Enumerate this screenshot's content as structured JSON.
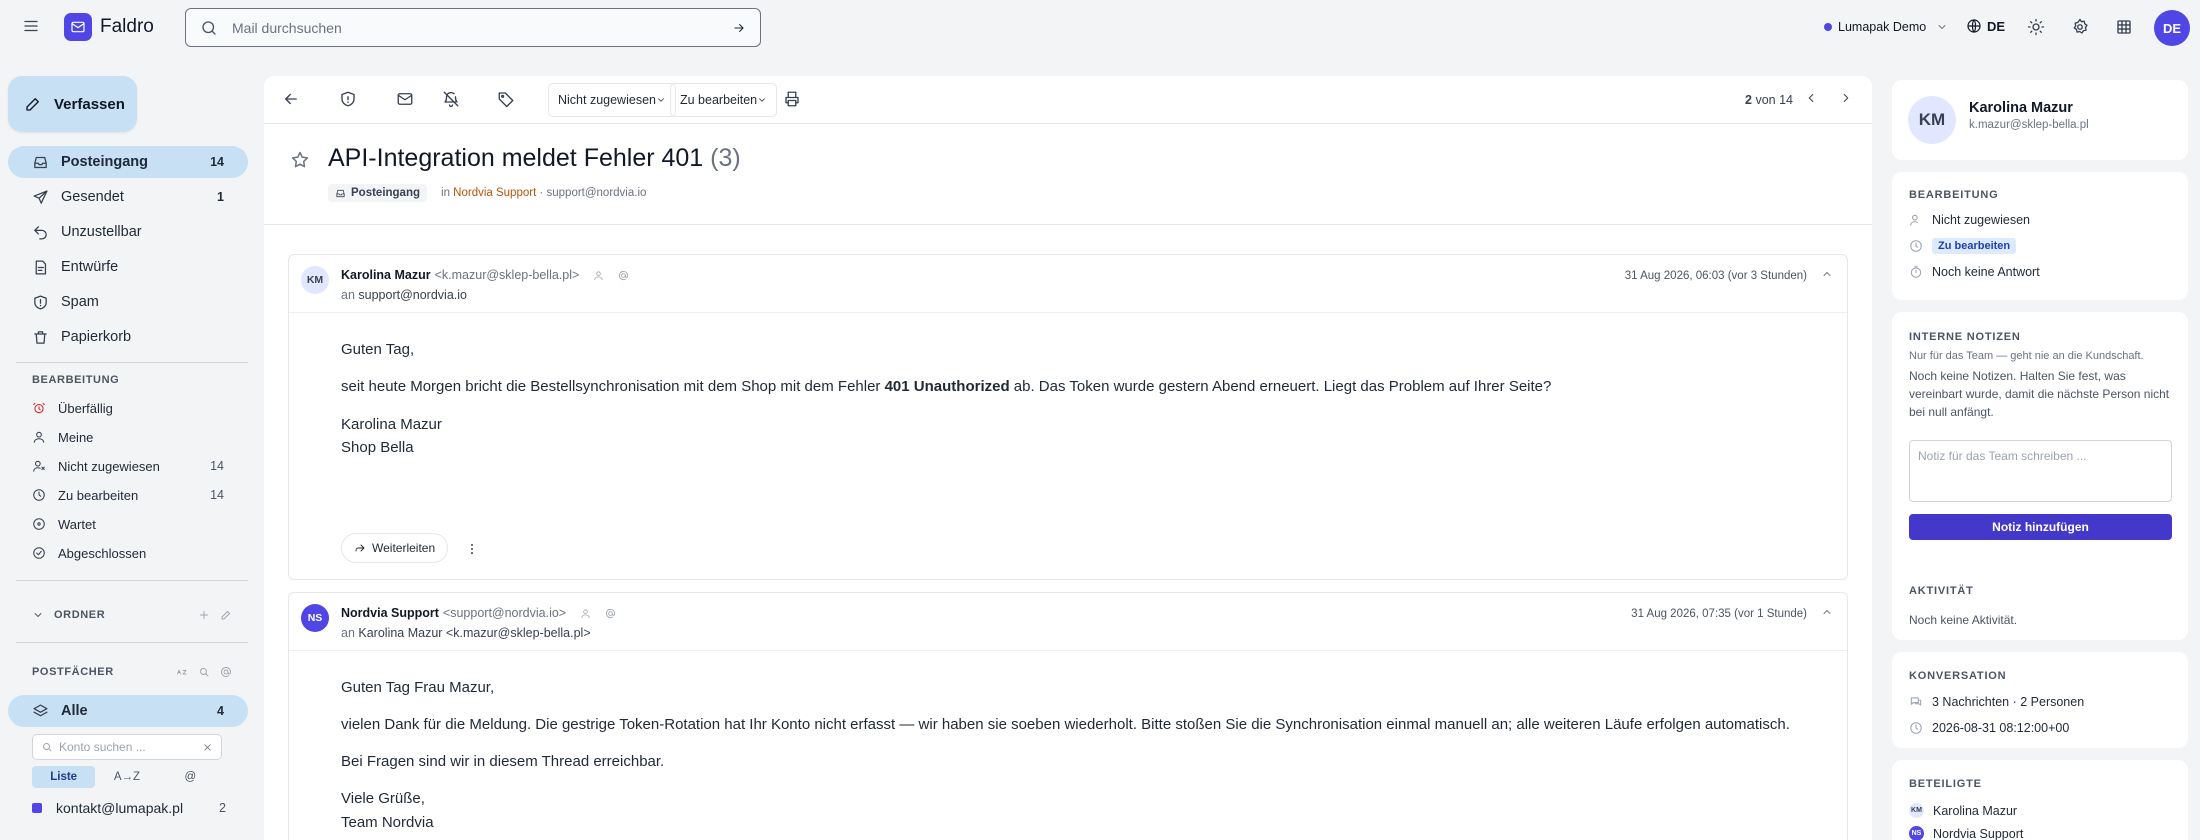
{
  "topbar": {
    "brand": "Faldro",
    "search_placeholder": "Mail durchsuchen",
    "workspace": "Lumapak Demo",
    "language": "DE",
    "user_initials": "DE"
  },
  "sidebar": {
    "compose_label": "Verfassen",
    "folders": [
      {
        "label": "Posteingang",
        "count": "14",
        "icon": "inbox-icon"
      },
      {
        "label": "Gesendet",
        "count": "1",
        "icon": "send-icon"
      },
      {
        "label": "Unzustellbar",
        "count": "",
        "icon": "bounce-icon"
      },
      {
        "label": "Entwürfe",
        "count": "",
        "icon": "draft-icon"
      },
      {
        "label": "Spam",
        "count": "",
        "icon": "spam-icon"
      },
      {
        "label": "Papierkorb",
        "count": "",
        "icon": "trash-icon"
      }
    ],
    "work_section": "BEARBEITUNG",
    "work_items": [
      {
        "label": "Überfällig",
        "count": "",
        "icon": "overdue-icon"
      },
      {
        "label": "Meine",
        "count": "",
        "icon": "user-icon"
      },
      {
        "label": "Nicht zugewiesen",
        "count": "14",
        "icon": "unassigned-icon"
      },
      {
        "label": "Zu bearbeiten",
        "count": "14",
        "icon": "clock-icon"
      },
      {
        "label": "Wartet",
        "count": "",
        "icon": "pause-icon"
      },
      {
        "label": "Abgeschlossen",
        "count": "",
        "icon": "check-circle-icon"
      }
    ],
    "folders_section": "ORDNER",
    "mailboxes_section": "POSTFÄCHER",
    "all_label": "Alle",
    "all_count": "4",
    "account_search_placeholder": "Konto suchen ...",
    "view_modes": [
      "Liste",
      "A→Z",
      "@"
    ],
    "accounts": [
      {
        "label": "kontakt@lumapak.pl",
        "count": "2",
        "color": "#4f46e5"
      }
    ]
  },
  "toolbar": {
    "assign_select": "Nicht zugewiesen",
    "status_select": "Zu bearbeiten",
    "pager_current": "2",
    "pager_text": "von 14"
  },
  "thread": {
    "subject": "API-Integration meldet Fehler 401",
    "count": "(3)",
    "folder_chip": "Posteingang",
    "in_label": "in",
    "org": "Nordvia Support",
    "org_mail": "· support@nordvia.io"
  },
  "messages": [
    {
      "initials": "KM",
      "sender": "Karolina Mazur",
      "sender_email": "<k.mazur@sklep-bella.pl>",
      "to_label": "an",
      "to": "support@nordvia.io",
      "date": "31 Aug 2026, 06:03 (vor 3 Stunden)",
      "greeting": "Guten Tag,",
      "body_pre": "seit heute Morgen bricht die Bestellsynchronisation mit dem Shop mit dem Fehler ",
      "body_bold": "401 Unauthorized",
      "body_post": " ab. Das Token wurde gestern Abend erneuert. Liegt das Problem auf Ihrer Seite?",
      "sig_1": "Karolina Mazur",
      "sig_2": "Shop Bella",
      "forward_label": "Weiterleiten"
    },
    {
      "initials": "NS",
      "sender": "Nordvia Support",
      "sender_email": "<support@nordvia.io>",
      "to_label": "an",
      "to": "Karolina Mazur <k.mazur@sklep-bella.pl>",
      "date": "31 Aug 2026, 07:35 (vor 1 Stunde)",
      "greeting": "Guten Tag Frau Mazur,",
      "body": "vielen Dank für die Meldung. Die gestrige Token-Rotation hat Ihr Konto nicht erfasst — wir haben sie soeben wiederholt. Bitte stoßen Sie die Synchronisation einmal manuell an; alle weiteren Läufe erfolgen automatisch.",
      "body_2": "Bei Fragen sind wir in diesem Thread erreichbar.",
      "sig_1": "Viele Grüße,",
      "sig_2": "Team Nordvia"
    }
  ],
  "right_panel": {
    "contact": {
      "initials": "KM",
      "name": "Karolina Mazur",
      "email": "k.mazur@sklep-bella.pl"
    },
    "work": {
      "title": "BEARBEITUNG",
      "assignee": "Nicht zugewiesen",
      "status": "Zu bearbeiten",
      "reply": "Noch keine Antwort"
    },
    "notes": {
      "title": "INTERNE NOTIZEN",
      "hint": "Nur für das Team — geht nie an die Kundschaft.",
      "empty": "Noch keine Notizen. Halten Sie fest, was vereinbart wurde, damit die nächste Person nicht bei null anfängt.",
      "placeholder": "Notiz für das Team schreiben ...",
      "button": "Notiz hinzufügen"
    },
    "activity": {
      "title": "AKTIVITÄT",
      "empty": "Noch keine Aktivität."
    },
    "conversation": {
      "title": "KONVERSATION",
      "summary": "3 Nachrichten · 2 Personen",
      "timestamp": "2026-08-31 08:12:00+00"
    },
    "participants": {
      "title": "BETEILIGTE",
      "list": [
        {
          "initials": "KM",
          "name": "Karolina Mazur"
        },
        {
          "initials": "NS",
          "name": "Nordvia Support"
        }
      ]
    }
  },
  "colors": {
    "accent": "#4f46e5",
    "active_bg": "#c7e0f4",
    "org": "#b45309"
  }
}
